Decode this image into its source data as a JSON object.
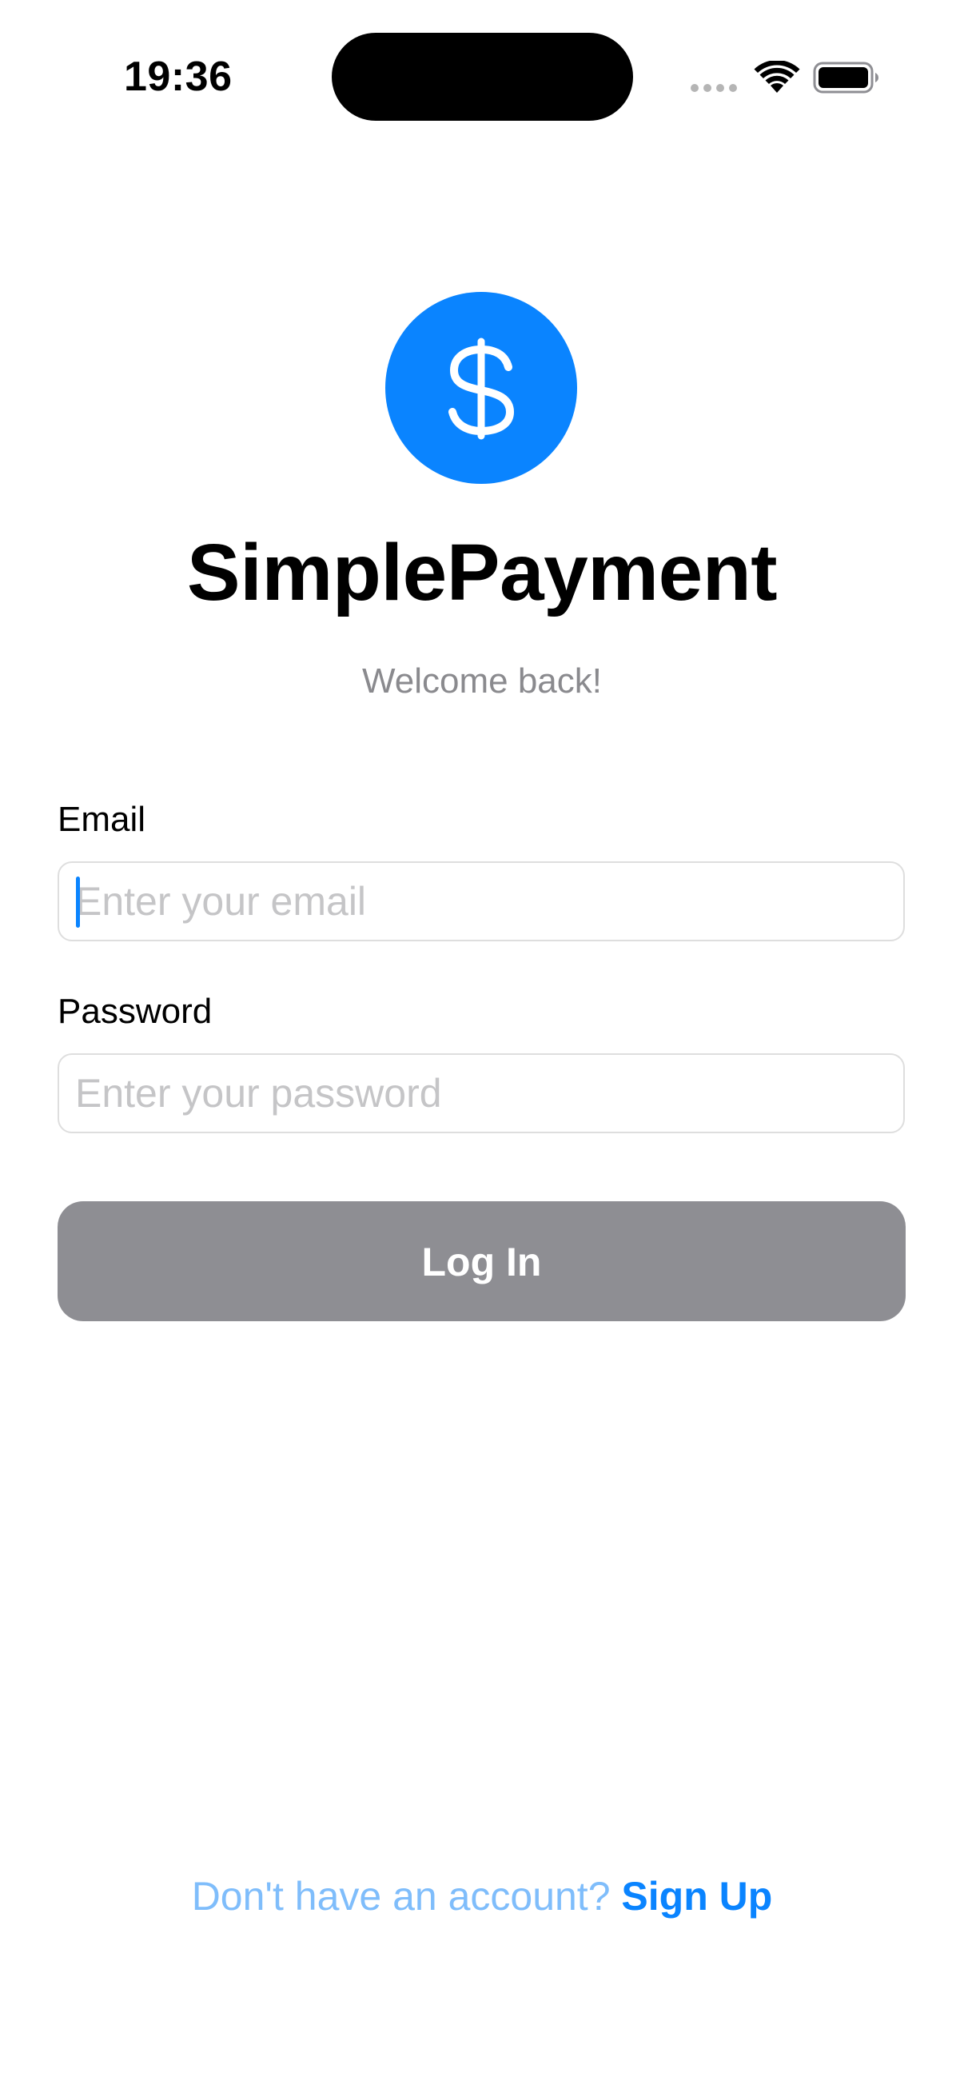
{
  "status_bar": {
    "time": "19:36"
  },
  "logo": {
    "icon": "dollar-sign-icon",
    "color": "#0a84ff"
  },
  "app": {
    "title": "SimplePayment",
    "subtitle": "Welcome back!"
  },
  "form": {
    "email": {
      "label": "Email",
      "value": "",
      "placeholder": "Enter your email"
    },
    "password": {
      "label": "Password",
      "value": "",
      "placeholder": "Enter your password"
    },
    "login_label": "Log In",
    "login_color": "#8e8e93"
  },
  "footer": {
    "prompt": "Don't have an account?",
    "link": "Sign Up"
  }
}
